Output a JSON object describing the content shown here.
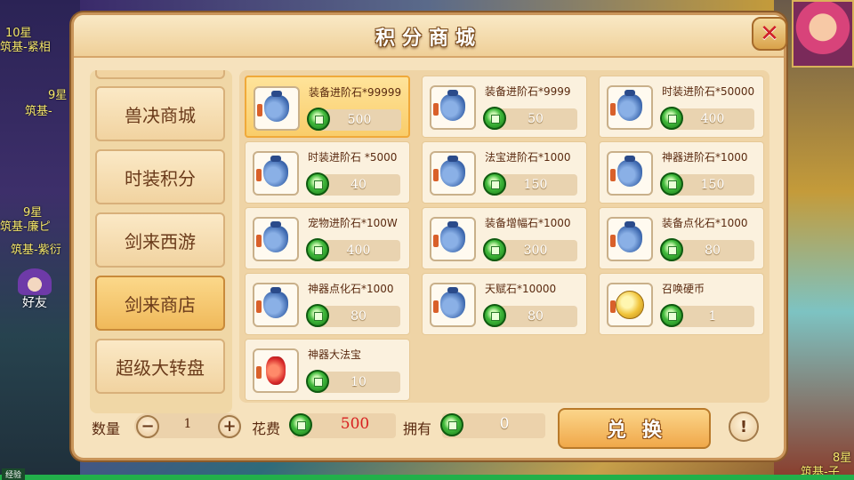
{
  "window": {
    "title": "积分商城",
    "close_symbol": "✕"
  },
  "background": {
    "labels": [
      "10星",
      "筑基-紧相",
      "9星",
      "筑基-",
      "9星",
      "筑基-廉ピ",
      "筑基-紫衍",
      "8星",
      "筑基-子"
    ],
    "friend_label": "好友",
    "exp_label": "经验"
  },
  "sidebar": {
    "tabs": [
      {
        "label": "兽决商城",
        "active": false
      },
      {
        "label": "时装积分",
        "active": false
      },
      {
        "label": "剑来西游",
        "active": false
      },
      {
        "label": "剑来商店",
        "active": true
      },
      {
        "label": "超级大转盘",
        "active": false
      }
    ]
  },
  "items": [
    {
      "name": "装备进阶石*99999",
      "price": "500",
      "icon": "bag-icon",
      "selected": true
    },
    {
      "name": "装备进阶石*9999",
      "price": "50",
      "icon": "bag-icon",
      "selected": false
    },
    {
      "name": "时装进阶石*50000",
      "price": "400",
      "icon": "bag-icon",
      "selected": false
    },
    {
      "name": "时装进阶石 *5000",
      "price": "40",
      "icon": "bag-icon",
      "selected": false
    },
    {
      "name": "法宝进阶石*1000",
      "price": "150",
      "icon": "bag-icon",
      "selected": false
    },
    {
      "name": "神器进阶石*1000",
      "price": "150",
      "icon": "bag-icon",
      "selected": false
    },
    {
      "name": "宠物进阶石*100W",
      "price": "400",
      "icon": "bag-icon",
      "selected": false
    },
    {
      "name": "装备增幅石*1000",
      "price": "300",
      "icon": "bag-icon",
      "selected": false
    },
    {
      "name": "装备点化石*1000",
      "price": "80",
      "icon": "bag-icon",
      "selected": false
    },
    {
      "name": "神器点化石*1000",
      "price": "80",
      "icon": "bag-icon",
      "selected": false
    },
    {
      "name": "天赋石*10000",
      "price": "80",
      "icon": "bag-icon",
      "selected": false
    },
    {
      "name": "召唤硬币",
      "price": "1",
      "icon": "coin-icon",
      "selected": false
    },
    {
      "name": "神器大法宝",
      "price": "10",
      "icon": "vase-icon",
      "selected": false
    }
  ],
  "footer": {
    "quantity_label": "数量",
    "quantity_value": "1",
    "minus_symbol": "−",
    "plus_symbol": "+",
    "cost_label": "花费",
    "cost_value": "500",
    "owned_label": "拥有",
    "owned_value": "0",
    "exchange_label": "兑换",
    "info_symbol": "!"
  },
  "colors": {
    "cost_value": "#d82020",
    "selected_card": "#f9cd6a",
    "currency_gem": "#3fb83a"
  }
}
